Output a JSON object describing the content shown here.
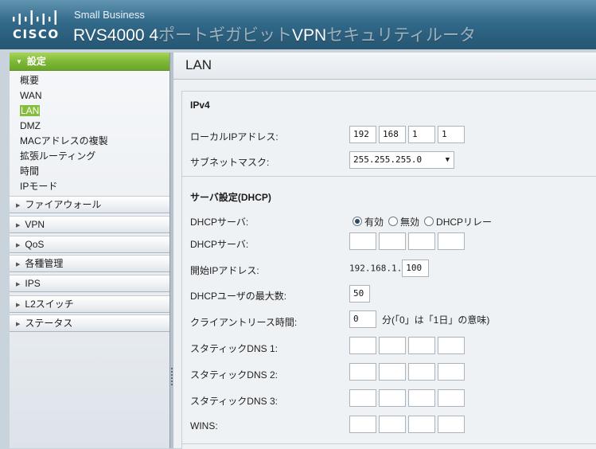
{
  "header": {
    "brand_word": "CISCO",
    "product_line": "Small Business",
    "title_main": "RVS4000 4",
    "title_faint_1": "ポートギガビット",
    "title_mid": "VPN",
    "title_faint_2": "セキュリティルータ"
  },
  "sidebar": {
    "active_section": "設定",
    "sub_items": [
      "概要",
      "WAN",
      "LAN",
      "DMZ",
      "MACアドレスの複製",
      "拡張ルーティング",
      "時間",
      "IPモード"
    ],
    "current_sub_item": "LAN",
    "sections": [
      "ファイアウォール",
      "VPN",
      "QoS",
      "各種管理",
      "IPS",
      "L2スイッチ",
      "ステータス"
    ]
  },
  "page": {
    "title": "LAN"
  },
  "ipv4": {
    "heading": "IPv4",
    "local_ip_label": "ローカルIPアドレス:",
    "local_ip": [
      "192",
      "168",
      "1",
      "1"
    ],
    "subnet_label": "サブネットマスク:",
    "subnet_value": "255.255.255.0"
  },
  "dhcp": {
    "heading": "サーバ設定(DHCP)",
    "server_label": "DHCPサーバ:",
    "server_options": [
      "有効",
      "無効",
      "DHCPリレー"
    ],
    "server_selected": "有効",
    "relay_label": "DHCPサーバ:",
    "relay_ip": [
      "",
      "",
      "",
      ""
    ],
    "start_ip_label": "開始IPアドレス:",
    "start_ip_prefix": "192.168.1.",
    "start_ip_last": "100",
    "max_users_label": "DHCPユーザの最大数:",
    "max_users": "50",
    "lease_label": "クライアントリース時間:",
    "lease_value": "0",
    "lease_note": "分(「0」は「1日」の意味)",
    "dns1_label": "スタティックDNS 1:",
    "dns2_label": "スタティックDNS 2:",
    "dns3_label": "スタティックDNS 3:",
    "wins_label": "WINS:"
  }
}
